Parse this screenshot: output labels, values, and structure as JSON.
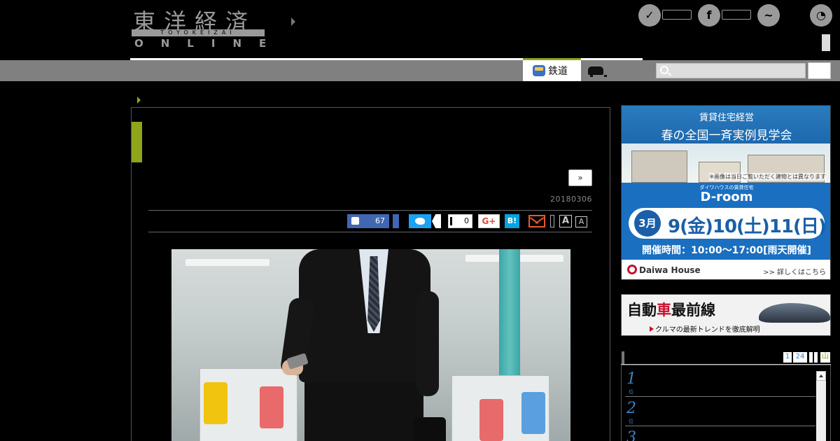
{
  "header": {
    "logo_kanji": "東洋経済",
    "logo_romaji": "TOYOKEIZAI",
    "logo_online": "ONLINE"
  },
  "social_icons": [
    "twitter-icon",
    "facebook-icon",
    "messenger-icon",
    "rss-icon"
  ],
  "nav": {
    "active_tab": "鉄道",
    "tab_icons": [
      "bus-icon",
      "car-icon"
    ],
    "search_icon": "search-icon"
  },
  "article": {
    "next_label": "»",
    "date": "20180306",
    "share": {
      "like_count": "67",
      "facebook_count": "0",
      "google_plus_label": "G+",
      "hatena_label": "B!",
      "font_large_label": "A",
      "font_small_label": "A"
    },
    "accent_color": "#8fa61a"
  },
  "ads": {
    "daiwa": {
      "line1": "賃貸住宅経営",
      "line2": "春の全国一斉実例見学会",
      "note": "※画像は当日ご覧いただく建物とは異なります",
      "brand_sub": "ダイワハウスの賃貸住宅",
      "brand_name": "D-room",
      "month": "3月",
      "days": "9(金)10(土)11(日)",
      "hours": "開催時間：10:00〜17:00[雨天開催]",
      "company": "Daiwa House",
      "more": ">> 詳しくはこちら"
    },
    "auto": {
      "title_pre": "自動",
      "title_red": "車",
      "title_post": "最前線",
      "sub": "クルマの最新トレンドを徹底解明"
    }
  },
  "ranking": {
    "tabs": [
      "1",
      "24",
      "",
      "",
      "山"
    ],
    "items": [
      {
        "num": "1",
        "suffix": "位"
      },
      {
        "num": "2",
        "suffix": "位"
      },
      {
        "num": "3",
        "suffix": ""
      }
    ]
  }
}
